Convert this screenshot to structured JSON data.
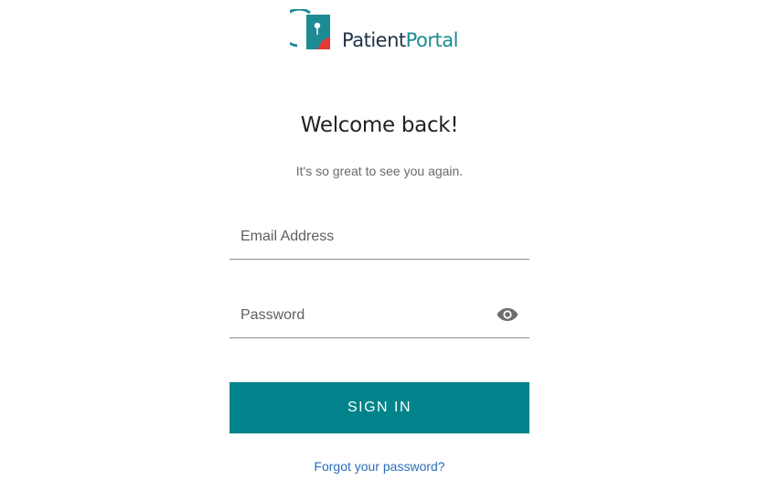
{
  "brand": {
    "name_part1": "Patient",
    "name_part2": "Portal",
    "logo_icon": "patient-portal-logo",
    "colors": {
      "dark_text": "#1e3246",
      "teal": "#1d8b93",
      "accent_red": "#e53935"
    }
  },
  "heading": {
    "title": "Welcome back!",
    "subtitle": "It's so great to see you again."
  },
  "form": {
    "email": {
      "placeholder": "Email Address",
      "value": ""
    },
    "password": {
      "placeholder": "Password",
      "value": "",
      "toggle_icon": "eye-icon"
    },
    "submit_label": "SIGN IN",
    "forgot_label": "Forgot your password?"
  },
  "colors": {
    "primary": "#00838a",
    "link": "#2a6ebb"
  }
}
